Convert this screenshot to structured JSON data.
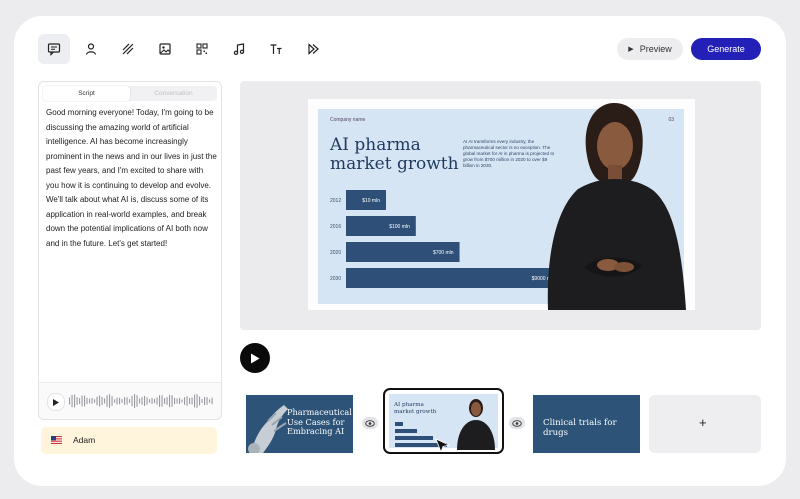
{
  "toolbar": {
    "icons": [
      "chat-icon",
      "person-icon",
      "hatch-icon",
      "image-icon",
      "qr-icon",
      "music-icon",
      "text-icon",
      "shapes-icon"
    ],
    "preview_label": "Preview",
    "generate_label": "Generate"
  },
  "script_panel": {
    "tabs": [
      "Script",
      "Conversation"
    ],
    "active_tab": "Script",
    "text": "Good morning everyone! Today, I'm going to be discussing the amazing world of artificial intelligence. AI has become increasingly prominent in the news and in our lives in just the past few years, and I'm excited to share with you how it is continuing to develop and evolve. We'll talk about what AI is, discuss some of its application in real-world examples, and break down the potential implications of AI both now and in the future. Let's get started!"
  },
  "voice": {
    "name": "Adam",
    "flag": "us-flag-icon"
  },
  "slide": {
    "company": "Company name",
    "page": "03",
    "title": "AI pharma market growth",
    "description": "AI AI transforms every industry, the pharmaceutical sector is no exception. The global market for AI in pharma is projected to grow from $700 million in 2020 to over $9 billion in 2030.",
    "chart_data": {
      "type": "bar",
      "categories": [
        "2012",
        "2016",
        "2020",
        "2030"
      ],
      "values": [
        10,
        100,
        700,
        9000
      ],
      "value_labels": [
        "$10 mln",
        "$100 mln",
        "$700 mln",
        "$9000 mln"
      ]
    }
  },
  "thumbnails": [
    {
      "title": "Pharmaceutical Use Cases for Embracing AI"
    },
    {
      "title": "AI pharma market growth"
    },
    {
      "title": "Clinical trials for drugs"
    }
  ],
  "add_slide_label": "+",
  "colors": {
    "accent": "#2320b8",
    "slide_navy": "#1f3a5f",
    "slide_bg": "#d6e5f4",
    "bar": "#2d4f78"
  }
}
